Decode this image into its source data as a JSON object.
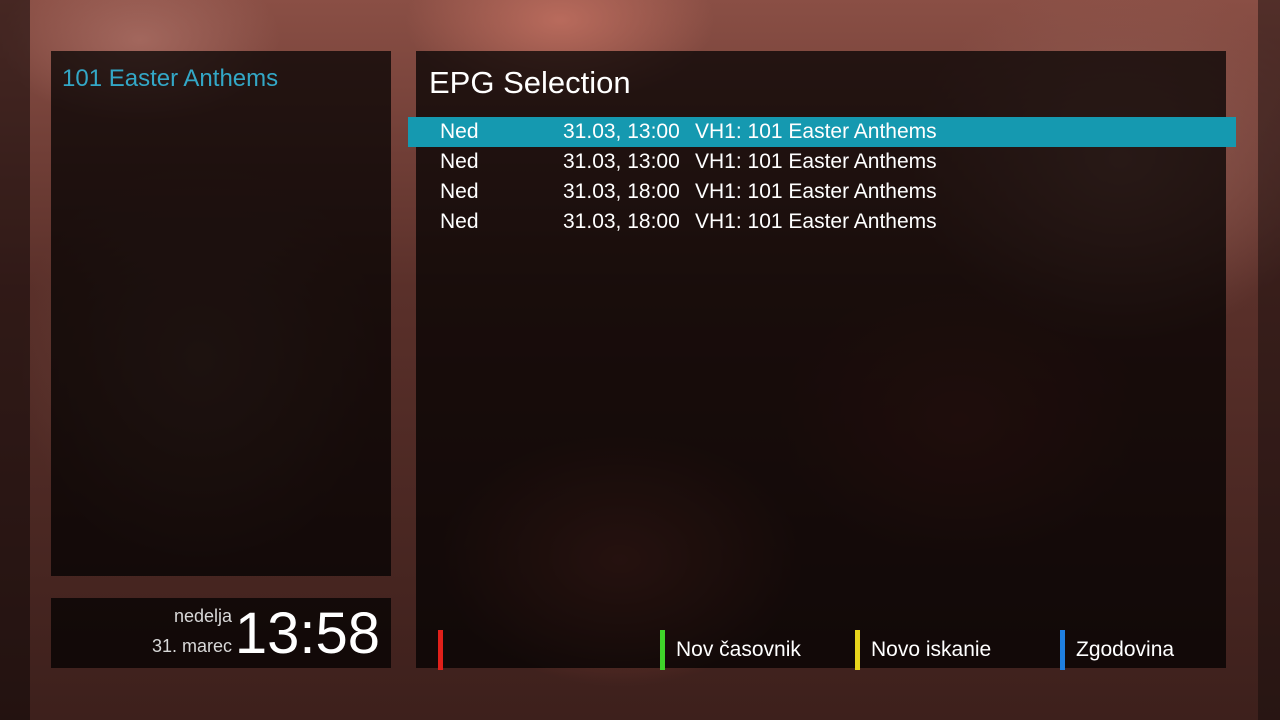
{
  "side_panel": {
    "title": "101 Easter Anthems"
  },
  "epg": {
    "title": "EPG Selection",
    "entries": [
      {
        "day": "Ned",
        "datetime": "31.03, 13:00",
        "event": "VH1: 101 Easter Anthems",
        "selected": true
      },
      {
        "day": "Ned",
        "datetime": "31.03, 13:00",
        "event": "VH1: 101 Easter Anthems",
        "selected": false
      },
      {
        "day": "Ned",
        "datetime": "31.03, 18:00",
        "event": "VH1: 101 Easter Anthems",
        "selected": false
      },
      {
        "day": "Ned",
        "datetime": "31.03, 18:00",
        "event": "VH1: 101 Easter Anthems",
        "selected": false
      }
    ]
  },
  "clock": {
    "weekday": "nedelja",
    "date": "31. marec",
    "time": "13:58"
  },
  "color_keys": {
    "red": {
      "label": "",
      "color": "#e0201a"
    },
    "green": {
      "label": "Nov časovnik",
      "color": "#3fd42a"
    },
    "yellow": {
      "label": "Novo iskanie",
      "color": "#e8d51c"
    },
    "blue": {
      "label": "Zgodovina",
      "color": "#1f7fe0"
    }
  },
  "colors": {
    "accent": "#33a7c6",
    "selection": "#1599b0"
  }
}
